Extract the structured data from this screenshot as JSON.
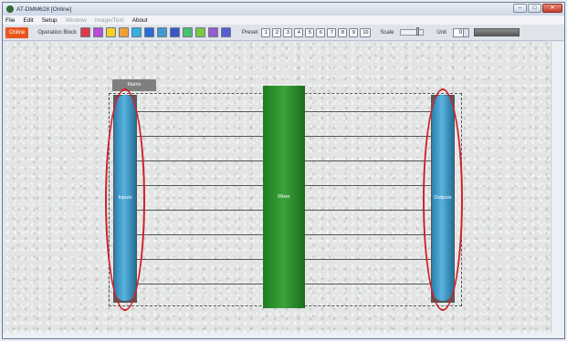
{
  "window": {
    "title": "AT-DMM628 [Online]",
    "controls": [
      "–",
      "□",
      "✕"
    ]
  },
  "menu": [
    "File",
    "Edit",
    "Setup",
    "Window",
    "Image/Text",
    "About"
  ],
  "menu_disabled": [
    false,
    false,
    false,
    true,
    true,
    false
  ],
  "toolbar": {
    "online_label": "Online",
    "operation_block_label": "Operation Block",
    "tool_icon_colors": [
      "#e0364b",
      "#b84ad8",
      "#f5d020",
      "#f0a030",
      "#35b0e0",
      "#2a6ad8",
      "#3f9bd0",
      "#3a56c8",
      "#49c06a",
      "#7ac943",
      "#9b59d0",
      "#5a5ad8"
    ],
    "preset_label": "Preset",
    "presets": [
      "1",
      "2",
      "3",
      "4",
      "5",
      "6",
      "7",
      "8",
      "9",
      "10"
    ],
    "scale_label": "Scale",
    "unit_label": "Unit",
    "unit_value": "0"
  },
  "canvas": {
    "matrix_label": "Matrix",
    "inputs_label": "Inputs",
    "mixer_label": "Mixer",
    "outputs_label": "Outputs",
    "highlight_color": "#d0202a"
  }
}
